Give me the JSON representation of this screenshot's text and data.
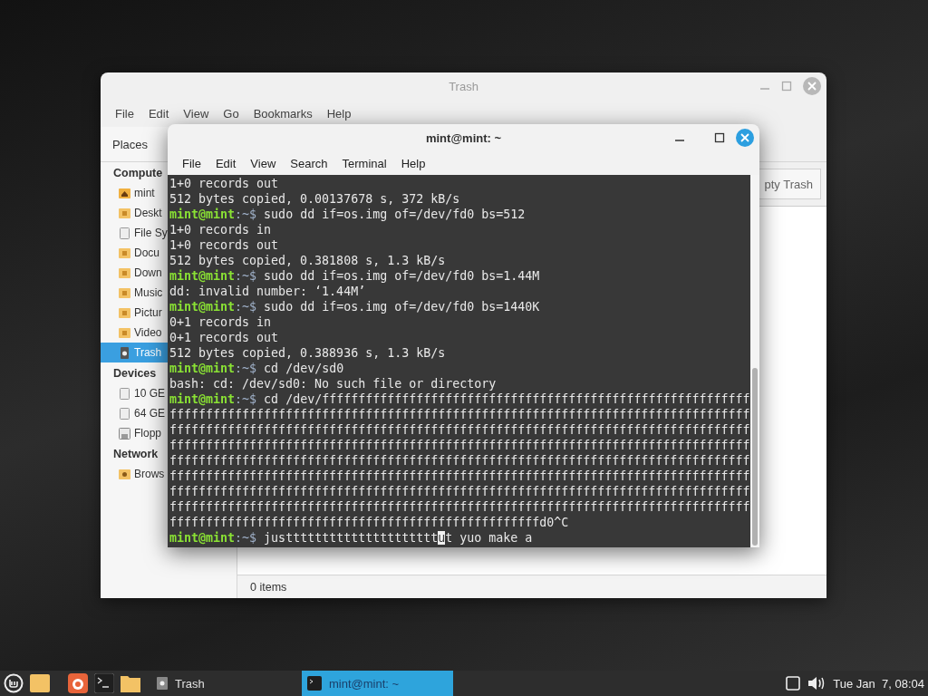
{
  "file_manager": {
    "title": "Trash",
    "active": false,
    "menu": [
      "File",
      "Edit",
      "View",
      "Go",
      "Bookmarks",
      "Help"
    ],
    "sidebar_header": "Places",
    "sections": [
      {
        "heading": "Compute",
        "items": [
          {
            "label": "mint",
            "kind": "home",
            "selected": false
          },
          {
            "label": "Deskt",
            "kind": "folder",
            "selected": false
          },
          {
            "label": "File Sy",
            "kind": "drive",
            "selected": false
          },
          {
            "label": "Docu",
            "kind": "folder",
            "selected": false
          },
          {
            "label": "Down",
            "kind": "folder",
            "selected": false
          },
          {
            "label": "Music",
            "kind": "folder",
            "selected": false
          },
          {
            "label": "Pictur",
            "kind": "folder",
            "selected": false
          },
          {
            "label": "Video",
            "kind": "folder",
            "selected": false
          },
          {
            "label": "Trash",
            "kind": "trash",
            "selected": true
          }
        ]
      },
      {
        "heading": "Devices",
        "items": [
          {
            "label": "10 GE",
            "kind": "drive",
            "selected": false
          },
          {
            "label": "64 GE",
            "kind": "drive",
            "selected": false
          },
          {
            "label": "Flopp",
            "kind": "floppy",
            "selected": false
          }
        ]
      },
      {
        "heading": "Network",
        "items": [
          {
            "label": "Brows",
            "kind": "network",
            "selected": false
          }
        ]
      }
    ],
    "empty_button": "pty Trash",
    "status": "0 items"
  },
  "terminal": {
    "title": "mint@mint: ~",
    "active": true,
    "menu": [
      "File",
      "Edit",
      "View",
      "Search",
      "Terminal",
      "Help"
    ],
    "lines": [
      {
        "kind": "output",
        "text": "1+0 records out"
      },
      {
        "kind": "output",
        "text": "512 bytes copied, 0.00137678 s, 372 kB/s"
      },
      {
        "kind": "prompt",
        "user": "mint@mint",
        "path": ":~$",
        "text": "sudo dd if=os.img of=/dev/fd0 bs=512"
      },
      {
        "kind": "output",
        "text": "1+0 records in"
      },
      {
        "kind": "output",
        "text": "1+0 records out"
      },
      {
        "kind": "output",
        "text": "512 bytes copied, 0.381808 s, 1.3 kB/s"
      },
      {
        "kind": "prompt",
        "user": "mint@mint",
        "path": ":~$",
        "text": "sudo dd if=os.img of=/dev/fd0 bs=1.44M"
      },
      {
        "kind": "output",
        "text": "dd: invalid number: ‘1.44M’"
      },
      {
        "kind": "prompt",
        "user": "mint@mint",
        "path": ":~$",
        "text": "sudo dd if=os.img of=/dev/fd0 bs=1440K"
      },
      {
        "kind": "output",
        "text": "0+1 records in"
      },
      {
        "kind": "output",
        "text": "0+1 records out"
      },
      {
        "kind": "output",
        "text": "512 bytes copied, 0.388936 s, 1.3 kB/s"
      },
      {
        "kind": "prompt",
        "user": "mint@mint",
        "path": ":~$",
        "text": "cd /dev/sd0"
      },
      {
        "kind": "output",
        "text": "bash: cd: /dev/sd0: No such file or directory"
      },
      {
        "kind": "prompt",
        "user": "mint@mint",
        "path": ":~$",
        "text": "cd /dev/fffffffffffffffffffffffffffffffffffffffffffffffffffffffffff"
      },
      {
        "kind": "output",
        "text": "ffffffffffffffffffffffffffffffffffffffffffffffffffffffffffffffffffffffffffffffff"
      },
      {
        "kind": "output",
        "text": "ffffffffffffffffffffffffffffffffffffffffffffffffffffffffffffffffffffffffffffffff"
      },
      {
        "kind": "output",
        "text": "ffffffffffffffffffffffffffffffffffffffffffffffffffffffffffffffffffffffffffffffff"
      },
      {
        "kind": "output",
        "text": "ffffffffffffffffffffffffffffffffffffffffffffffffffffffffffffffffffffffffffffffff"
      },
      {
        "kind": "output",
        "text": "ffffffffffffffffffffffffffffffffffffffffffffffffffffffffffffffffffffffffffffffff"
      },
      {
        "kind": "output",
        "text": "ffffffffffffffffffffffffffffffffffffffffffffffffffffffffffffffffffffffffffffffff"
      },
      {
        "kind": "output",
        "text": "ffffffffffffffffffffffffffffffffffffffffffffffffffffffffffffffffffffffffffffffff"
      },
      {
        "kind": "output",
        "text": "fffffffffffffffffffffffffffffffffffffffffffffffffffd0^C"
      },
      {
        "kind": "input",
        "user": "mint@mint",
        "path": ":~$",
        "text": "justtttttttttttttttttttt",
        "cursor": "u",
        "after": "t yuo make a"
      }
    ]
  },
  "taskbar": {
    "windows": [
      {
        "label": "Trash",
        "kind": "files",
        "selected": false
      },
      {
        "label": "mint@mint: ~",
        "kind": "terminal",
        "selected": true
      }
    ],
    "clock": "Tue Jan  7, 08:04"
  }
}
